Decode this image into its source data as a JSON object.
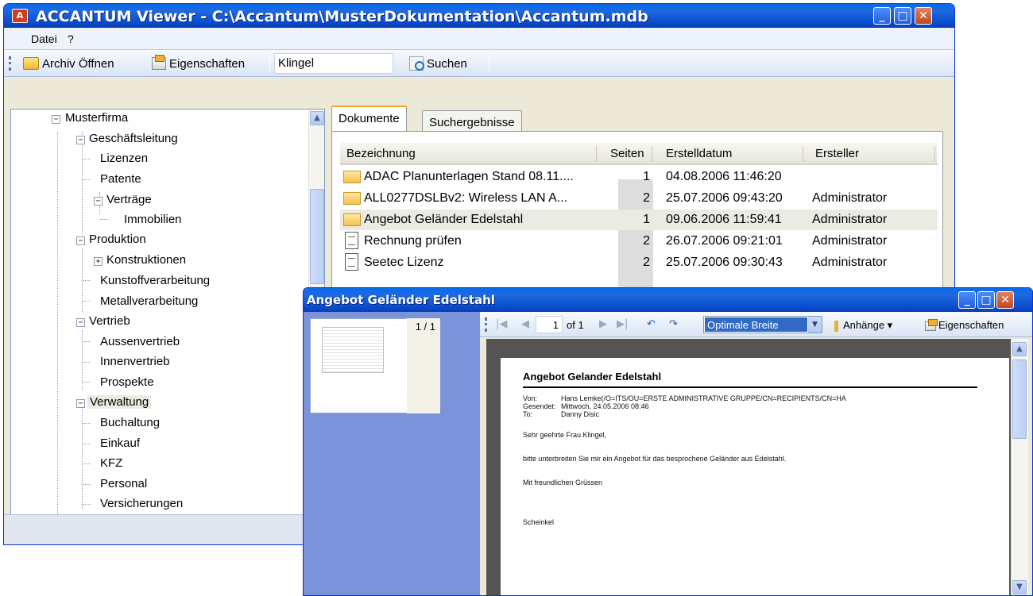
{
  "main_window": {
    "app_icon_glyph": "A",
    "title": "ACCANTUM Viewer - C:\\Accantum\\MusterDokumentation\\Accantum.mdb",
    "menu": [
      "Datei",
      "?"
    ],
    "toolbar": {
      "open_archive_label": "Archiv Öffnen",
      "properties_label": "Eigenschaften",
      "search_value": "Klingel",
      "search_button_label": "Suchen"
    }
  },
  "tree": {
    "items": [
      "Musterfirma",
      "Geschäftsleitung",
      "Lizenzen",
      "Patente",
      "Verträge",
      "Immobilien",
      "Produktion",
      "Konstruktionen",
      "Kunstoffverarbeitung",
      "Metallverarbeitung",
      "Vertrieb",
      "Aussenvertrieb",
      "Innenvertrieb",
      "Prospekte",
      "Verwaltung",
      "Buchaltung",
      "Einkauf",
      "KFZ",
      "Personal",
      "Versicherungen"
    ],
    "selected": "Verwaltung"
  },
  "tabs": [
    "Dokumente",
    "Suchergebnisse"
  ],
  "documents": {
    "columns": [
      "Bezeichnung",
      "Seiten",
      "Erstelldatum",
      "Ersteller"
    ],
    "rows": [
      {
        "name": "ADAC Planunterlagen Stand 08.11....",
        "pages": "1",
        "date": "04.08.2006 11:46:20",
        "author": "",
        "icon": "envelope-icon"
      },
      {
        "name": "ALL0277DSLBv2: Wireless LAN A...",
        "pages": "2",
        "date": "25.07.2006 09:43:20",
        "author": "Administrator",
        "icon": "envelope-icon"
      },
      {
        "name": "Angebot Geländer Edelstahl",
        "pages": "1",
        "date": "09.06.2006 11:59:41",
        "author": "Administrator",
        "icon": "envelope-icon"
      },
      {
        "name": "Rechnung prüfen",
        "pages": "2",
        "date": "26.07.2006 09:21:01",
        "author": "Administrator",
        "icon": "document-icon"
      },
      {
        "name": "Seetec Lizenz",
        "pages": "2",
        "date": "25.07.2006 09:30:43",
        "author": "Administrator",
        "icon": "document-icon"
      }
    ]
  },
  "viewer": {
    "title": "Angebot Geländer Edelstahl",
    "thumb_counter": "1 / 1",
    "toolbar": {
      "page_value": "1",
      "page_of": "of 1",
      "zoom": "Optimale Breite",
      "attachments_label": "Anhänge",
      "properties_label": "Eigenschaften"
    },
    "document": {
      "heading": "Angebot Gelander Edelstahl",
      "meta": [
        {
          "label": "Von:",
          "value": "Hans  Lemke(/O=ITS/OU=ERSTE  ADMINISTRATIVE  GRUPPE/CN=RECIPIENTS/CN=HA"
        },
        {
          "label": "Gesendet:",
          "value": "Mittwoch, 24.05.2006 08:46"
        },
        {
          "label": "To:",
          "value": "Danny Disic"
        }
      ],
      "body": [
        "Sehr geehrte Frau Klingel,",
        "bitte unterbreiten Sie mir ein Angebot für das besprochene Geländer aus Edelstahl.",
        "Mit freundlichen Grüssen",
        "Scheinkel"
      ]
    }
  }
}
